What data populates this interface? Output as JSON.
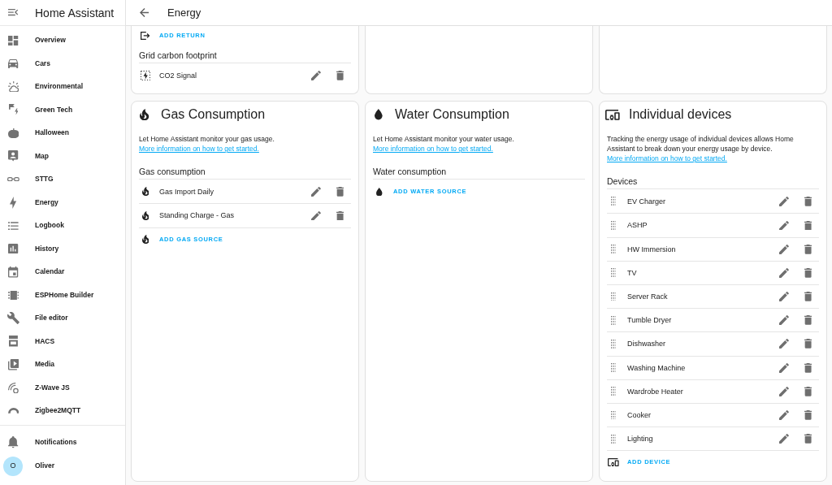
{
  "sidebar": {
    "title": "Home Assistant",
    "items": [
      {
        "label": "Overview"
      },
      {
        "label": "Cars"
      },
      {
        "label": "Environmental"
      },
      {
        "label": "Green Tech"
      },
      {
        "label": "Halloween"
      },
      {
        "label": "Map"
      },
      {
        "label": "STTG"
      },
      {
        "label": "Energy"
      },
      {
        "label": "Logbook"
      },
      {
        "label": "History"
      },
      {
        "label": "Calendar"
      },
      {
        "label": "ESPHome Builder"
      },
      {
        "label": "File editor"
      },
      {
        "label": "HACS"
      },
      {
        "label": "Media"
      },
      {
        "label": "Z-Wave JS"
      },
      {
        "label": "Zigbee2MQTT"
      }
    ],
    "footer_items": [
      {
        "label": "Notifications"
      }
    ],
    "user": {
      "initial": "O",
      "name": "Oliver"
    }
  },
  "top_bar": {
    "title": "Energy"
  },
  "grid_card": {
    "add_button": "ADD RETURN",
    "section_heading": "Grid carbon footprint",
    "sources": [
      {
        "name": "CO2 Signal"
      }
    ]
  },
  "cards": [
    {
      "kind": "gas",
      "title": "Gas Consumption",
      "description": "Let Home Assistant monitor your gas usage.",
      "link": "More information on how to get started.",
      "section_heading": "Gas consumption",
      "sources": [
        {
          "name": "Gas Import Daily"
        },
        {
          "name": "Standing Charge - Gas"
        }
      ],
      "add_button": "ADD GAS SOURCE"
    },
    {
      "kind": "water",
      "title": "Water Consumption",
      "description": "Let Home Assistant monitor your water usage.",
      "link": "More information on how to get started.",
      "section_heading": "Water consumption",
      "add_button": "ADD WATER SOURCE"
    },
    {
      "kind": "devices",
      "title": "Individual devices",
      "description": "Tracking the energy usage of individual devices allows Home Assistant to break down your energy usage by device.",
      "link": "More information on how to get started.",
      "section_heading": "Devices",
      "sources": [
        {
          "name": "EV Charger"
        },
        {
          "name": "ASHP"
        },
        {
          "name": "HW Immersion"
        },
        {
          "name": "TV"
        },
        {
          "name": "Server Rack"
        },
        {
          "name": "Tumble Dryer"
        },
        {
          "name": "Dishwasher"
        },
        {
          "name": "Washing Machine"
        },
        {
          "name": "Wardrobe Heater"
        },
        {
          "name": "Cooker"
        },
        {
          "name": "Lighting"
        }
      ],
      "add_button": "ADD DEVICE"
    }
  ]
}
